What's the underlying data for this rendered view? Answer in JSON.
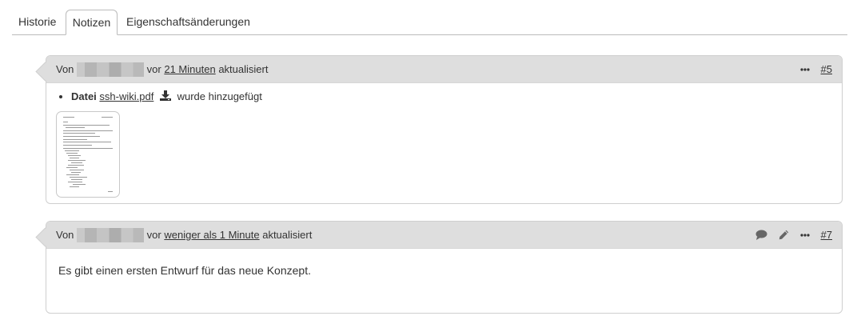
{
  "tabs": [
    {
      "label": "Historie",
      "active": false
    },
    {
      "label": "Notizen",
      "active": true
    },
    {
      "label": "Eigenschaftsänderungen",
      "active": false
    }
  ],
  "journals": [
    {
      "von": "Von",
      "vor": "vor",
      "time_link": "21 Minuten",
      "updated": "aktualisiert",
      "number": "#5",
      "details": {
        "bullet_label": "Datei",
        "file_name": "ssh-wiki.pdf",
        "suffix": "wurde hinzugefügt"
      }
    },
    {
      "von": "Von",
      "vor": "vor",
      "time_link": "weniger als 1 Minute",
      "updated": "aktualisiert",
      "number": "#7",
      "notes": "Es gibt einen ersten Entwurf für das neue Konzept."
    }
  ],
  "icons": {
    "download": "download-icon",
    "comment": "comment-icon",
    "edit": "pencil-icon",
    "more": "more-icon"
  }
}
